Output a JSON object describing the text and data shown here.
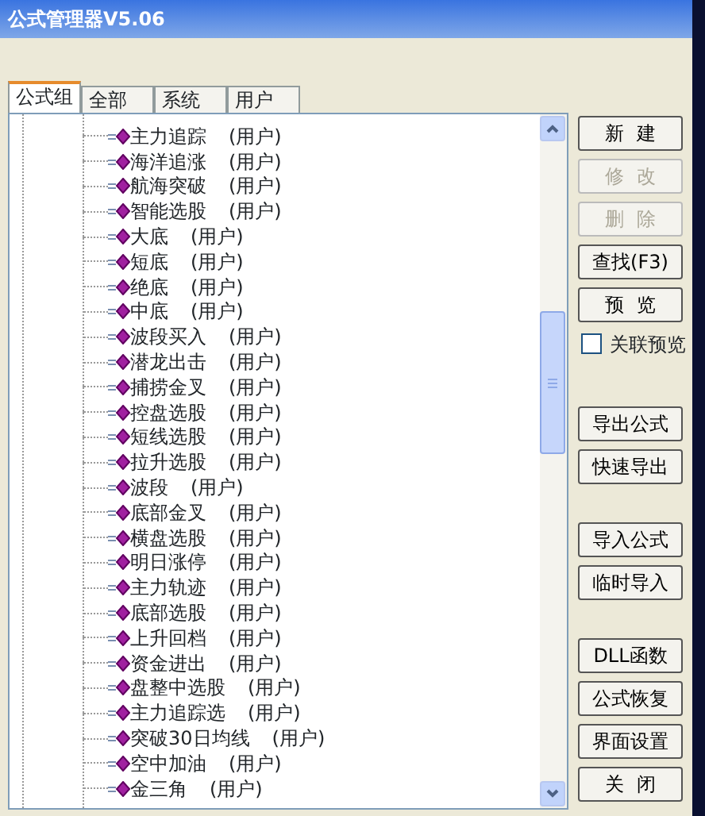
{
  "window": {
    "title": "公式管理器V5.06"
  },
  "tabs": [
    {
      "label": "公式组",
      "selected": true
    },
    {
      "label": "全部",
      "selected": false
    },
    {
      "label": "系统",
      "selected": false
    },
    {
      "label": "用户",
      "selected": false
    }
  ],
  "tree": {
    "items": [
      {
        "name": "主力追踪",
        "tag": "(用户)"
      },
      {
        "name": "海洋追涨",
        "tag": "(用户)"
      },
      {
        "name": "航海突破",
        "tag": "(用户)"
      },
      {
        "name": "智能选股",
        "tag": "(用户)"
      },
      {
        "name": "大底",
        "tag": "(用户)"
      },
      {
        "name": "短底",
        "tag": "(用户)"
      },
      {
        "name": "绝底",
        "tag": "(用户)"
      },
      {
        "name": "中底",
        "tag": "(用户)"
      },
      {
        "name": "波段买入",
        "tag": "(用户)"
      },
      {
        "name": "潜龙出击",
        "tag": "(用户)"
      },
      {
        "name": "捕捞金叉",
        "tag": "(用户)"
      },
      {
        "name": "控盘选股",
        "tag": "(用户)"
      },
      {
        "name": "短线选股",
        "tag": "(用户)"
      },
      {
        "name": "拉升选股",
        "tag": "(用户)"
      },
      {
        "name": "波段",
        "tag": "(用户)"
      },
      {
        "name": "底部金叉",
        "tag": "(用户)"
      },
      {
        "name": "横盘选股",
        "tag": "(用户)"
      },
      {
        "name": "明日涨停",
        "tag": "(用户)"
      },
      {
        "name": "主力轨迹",
        "tag": "(用户)"
      },
      {
        "name": "底部选股",
        "tag": "(用户)"
      },
      {
        "name": "上升回档",
        "tag": "(用户)"
      },
      {
        "name": "资金进出",
        "tag": "(用户)"
      },
      {
        "name": "盘整中选股",
        "tag": "(用户)"
      },
      {
        "name": "主力追踪选",
        "tag": "(用户)"
      },
      {
        "name": "突破30日均线",
        "tag": "(用户)"
      },
      {
        "name": "空中加油",
        "tag": "(用户)"
      },
      {
        "name": "金三角",
        "tag": "(用户)"
      }
    ]
  },
  "actions": [
    {
      "kind": "button",
      "label": "新  建",
      "disabled": false
    },
    {
      "kind": "button",
      "label": "修  改",
      "disabled": true
    },
    {
      "kind": "button",
      "label": "删  除",
      "disabled": true
    },
    {
      "kind": "button",
      "label": "查找(F3)",
      "disabled": false
    },
    {
      "kind": "button",
      "label": "预  览",
      "disabled": false
    },
    {
      "kind": "checkbox",
      "label": "关联预览",
      "checked": false
    },
    {
      "kind": "gap"
    },
    {
      "kind": "button",
      "label": "导出公式",
      "disabled": false
    },
    {
      "kind": "button",
      "label": "快速导出",
      "disabled": false
    },
    {
      "kind": "gap"
    },
    {
      "kind": "button",
      "label": "导入公式",
      "disabled": false
    },
    {
      "kind": "button",
      "label": "临时导入",
      "disabled": false
    },
    {
      "kind": "gap"
    },
    {
      "kind": "button",
      "label": "DLL函数",
      "disabled": false
    },
    {
      "kind": "button",
      "label": "公式恢复",
      "disabled": false
    },
    {
      "kind": "button",
      "label": "界面设置",
      "disabled": false
    },
    {
      "kind": "button",
      "label": "关  闭",
      "disabled": false
    }
  ]
}
